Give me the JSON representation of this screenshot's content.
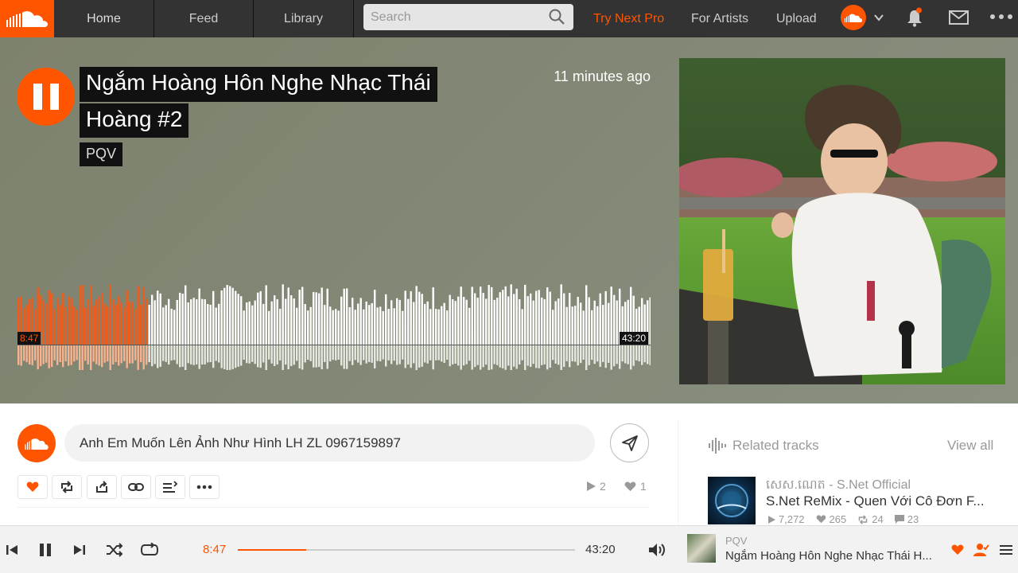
{
  "nav": {
    "tabs": [
      {
        "label": "Home"
      },
      {
        "label": "Feed"
      },
      {
        "label": "Library"
      }
    ],
    "search_placeholder": "Search",
    "links": {
      "pro": "Try Next Pro",
      "artists": "For Artists",
      "upload": "Upload"
    },
    "brand_color": "#ff5500"
  },
  "hero": {
    "title_line1": "Ngắm Hoàng Hôn Nghe Nhạc Thái",
    "title_line2": "Hoàng #2",
    "artist": "PQV",
    "posted": "11 minutes ago",
    "elapsed": "8:47",
    "duration": "43:20",
    "progress": 0.203
  },
  "comment": {
    "value": "Anh Em Muốn Lên Ảnh Như Hình LH ZL 0967159897"
  },
  "stats": {
    "plays": "2",
    "likes": "1"
  },
  "related": {
    "heading": "Related tracks",
    "view_all": "View all",
    "items": [
      {
        "artist": "សេស.ណេត - S.Net Official",
        "title": "S.Net ReMix - Quen Với Cô Đơn F...",
        "plays": "7,272",
        "likes": "265",
        "reposts": "24",
        "comments": "23"
      }
    ]
  },
  "player": {
    "elapsed": "8:47",
    "duration": "43:20",
    "progress": 0.203,
    "artist": "PQV",
    "title": "Ngắm Hoàng Hôn Nghe Nhạc Thái H..."
  }
}
